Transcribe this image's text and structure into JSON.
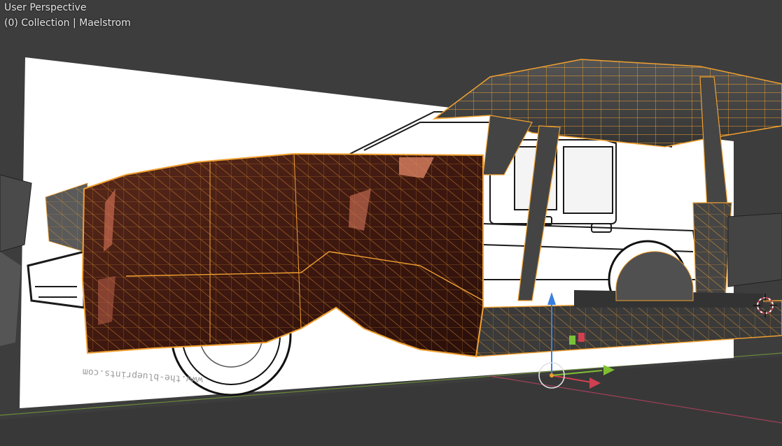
{
  "viewport": {
    "view_name": "User Perspective",
    "collection_info": "(0) Collection | Maelstrom",
    "background_color": "#3d3d3d"
  },
  "blueprint": {
    "watermark": "www.the-blueprints.com"
  },
  "scene": {
    "selection_color": "#f0a030",
    "body_color": "#4a1e14",
    "grid_axis_color": "#6b8a3a",
    "axis_x_color": "#d04050",
    "axis_y_color": "#80c030",
    "axis_z_color": "#3a7fe0",
    "icons": [
      "3d-cursor-icon",
      "gizmo-origin-icon",
      "z-axis-arrow-icon",
      "x-axis-arrow-icon",
      "y-axis-arrow-icon"
    ]
  }
}
